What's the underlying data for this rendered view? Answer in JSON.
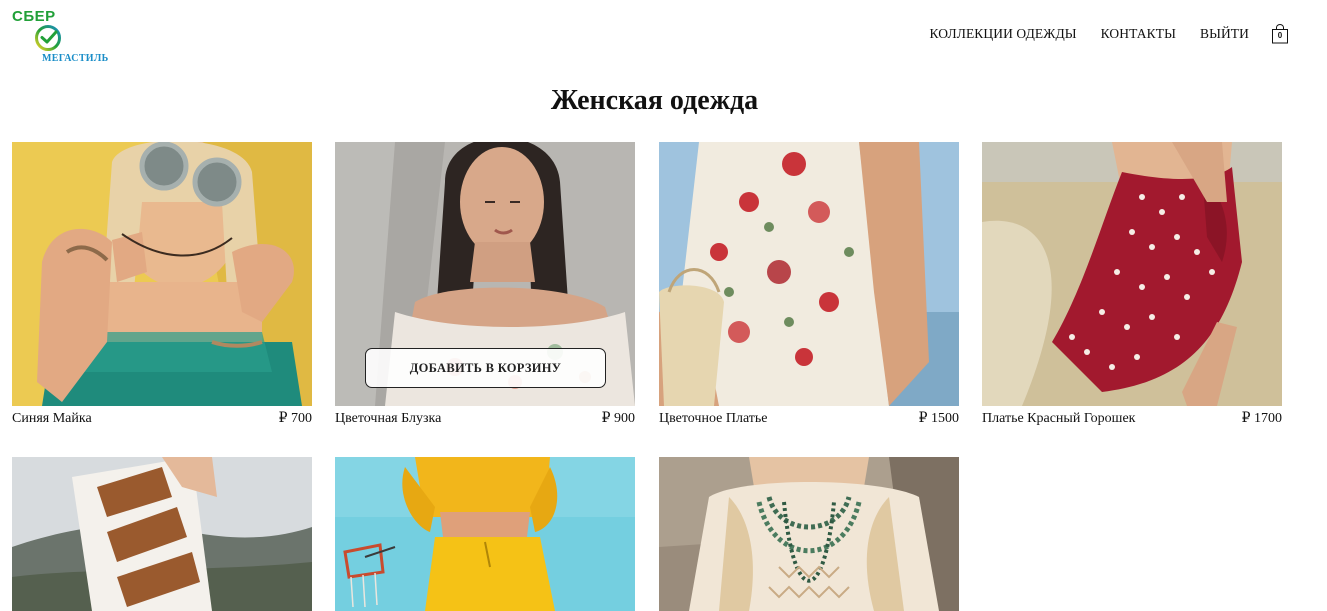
{
  "logo": {
    "top_text": "СБЕР",
    "bottom_text": "МЕГАСТИЛЬ",
    "colors": {
      "green": "#21a038",
      "blue": "#1b8ec8",
      "yellow": "#f2d624"
    }
  },
  "nav": {
    "items": [
      {
        "label": "КОЛЛЕКЦИИ ОДЕЖДЫ"
      },
      {
        "label": "КОНТАКТЫ"
      },
      {
        "label": "ВЫЙТИ"
      }
    ],
    "cart": {
      "icon": "shopping-bag-icon",
      "count": "0"
    }
  },
  "page": {
    "title": "Женская одежда"
  },
  "products": [
    {
      "name": "Синяя Майка",
      "price": "₽ 700",
      "photo": "yellow-wall-sunglasses"
    },
    {
      "name": "Цветочная Блузка",
      "price": "₽ 900",
      "photo": "concrete-wall-portrait",
      "hover_button": "ДОБАВИТЬ В КОРЗИНУ"
    },
    {
      "name": "Цветочное Платье",
      "price": "₽ 1500",
      "photo": "floral-dress-sky"
    },
    {
      "name": "Платье Красный Горошек",
      "price": "₽ 1700",
      "photo": "polka-dot-field"
    },
    {
      "name": "",
      "price": "",
      "photo": "chevron-sweater-hills"
    },
    {
      "name": "",
      "price": "",
      "photo": "yellow-tracksuit-basketball"
    },
    {
      "name": "",
      "price": "",
      "photo": "braids-necklace"
    }
  ]
}
